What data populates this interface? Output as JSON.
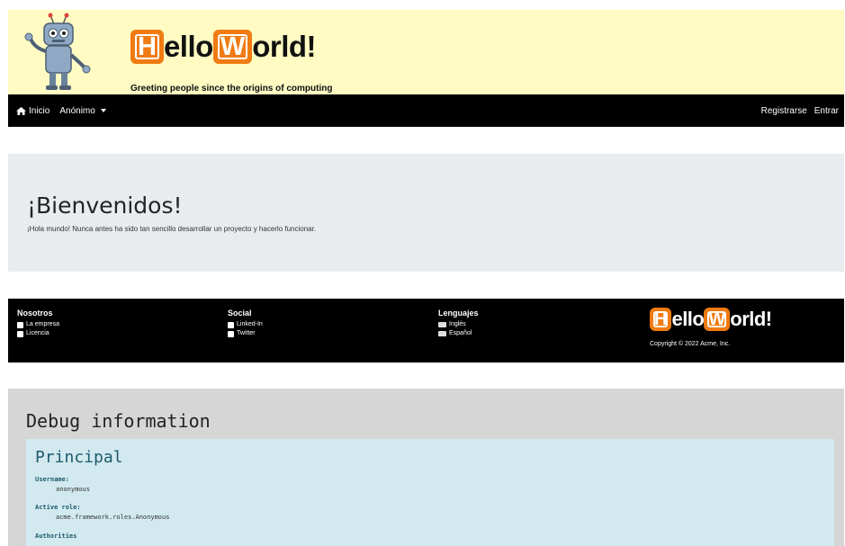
{
  "header": {
    "logo_box1": "H",
    "logo_text1": "ello",
    "logo_box2": "W",
    "logo_text2": "orld!",
    "tagline": "Greeting people since the origins of computing"
  },
  "navbar": {
    "home_label": "Inicio",
    "user_menu_label": "Anónimo",
    "register_label": "Registrarse",
    "login_label": "Entrar"
  },
  "jumbotron": {
    "title": "¡Bienvenidos!",
    "text": "¡Hola mundo! Nunca antes ha sido tan sencillo desarrollar un proyecto y hacerlo funcionar."
  },
  "footer": {
    "about": {
      "title": "Nosotros",
      "items": [
        "La empresa",
        "Licencia"
      ]
    },
    "social": {
      "title": "Social",
      "items": [
        "Linked-In",
        "Twitter"
      ]
    },
    "languages": {
      "title": "Lenguajes",
      "items": [
        "Inglés",
        "Español"
      ]
    },
    "logo_box1": "H",
    "logo_text1": "ello",
    "logo_box2": "W",
    "logo_text2": "orld!",
    "copyright": "Copyright © 2022 Acme, Inc."
  },
  "debug": {
    "title": "Debug information",
    "principal_title": "Principal",
    "username_label": "Username:",
    "username_value": "anonymous",
    "role_label": "Active role:",
    "role_value": "acme.framework.roles.Anonymous",
    "authorities_label": "Authorities"
  },
  "colors": {
    "banner_bg": "#fffbc3",
    "logo_orange": "#f07b12",
    "navbar_bg": "#000000",
    "jumbotron_bg": "#e9ecef",
    "debug_bg": "#d6d6d6",
    "principal_bg": "#d1e9ef"
  }
}
